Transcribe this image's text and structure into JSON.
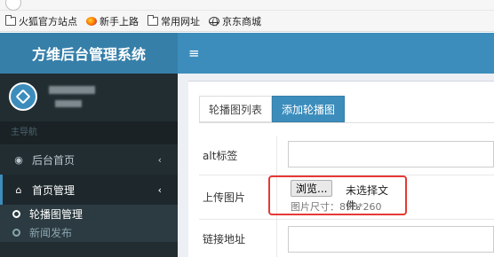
{
  "bookmarks": [
    {
      "label": "火狐官方站点",
      "icon": "folder-icon"
    },
    {
      "label": "新手上路",
      "icon": "firefox-icon"
    },
    {
      "label": "常用网址",
      "icon": "folder-icon"
    },
    {
      "label": "京东商城",
      "icon": "globe-icon"
    }
  ],
  "app": {
    "title": "方维后台管理系统",
    "menu_toggle": "≡"
  },
  "sidebar": {
    "header": "主导航",
    "items": [
      {
        "label": "后台首页",
        "icon": "dashboard-icon",
        "chevron": "‹"
      },
      {
        "label": "首页管理",
        "icon": "home-icon",
        "chevron": "‹"
      }
    ],
    "subitems": [
      {
        "label": "轮播图管理"
      },
      {
        "label": "新闻发布"
      }
    ]
  },
  "tabs": [
    {
      "label": "轮播图列表"
    },
    {
      "label": "添加轮播图"
    }
  ],
  "form": {
    "alt_label": "alt标签",
    "upload_label": "上传图片",
    "browse_button": "浏览...",
    "file_status": "未选择文件。",
    "image_size": "图片尺寸：890*260",
    "link_label": "链接地址"
  },
  "colors": {
    "header_primary": "#3c8dbc",
    "header_logo": "#367fa9",
    "sidebar_bg": "#222d32",
    "highlight": "#e53935"
  }
}
